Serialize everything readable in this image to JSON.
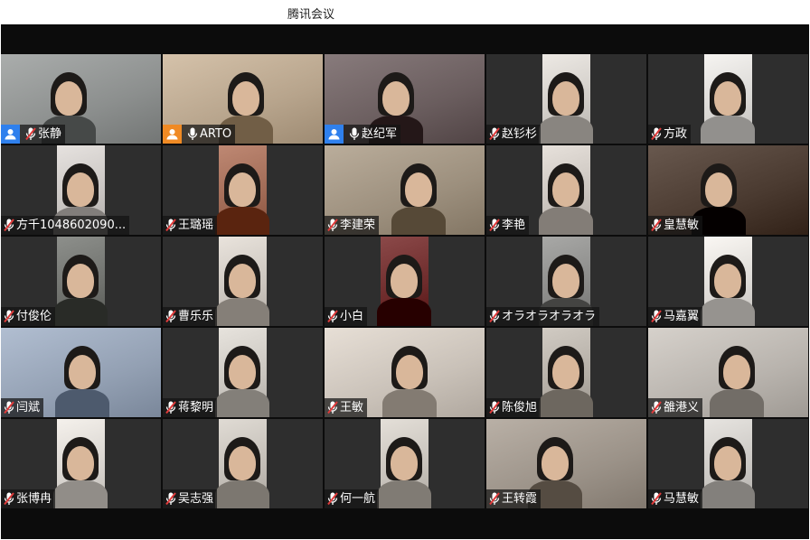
{
  "window": {
    "title": "腾讯会议"
  },
  "participants": [
    {
      "name": "张静",
      "mic": "muted",
      "role": "host",
      "badge_color": "#2f80ed",
      "bg": "#8c8f8e"
    },
    {
      "name": "ARTO",
      "mic": "active",
      "role": "host",
      "badge_color": "#f08a24",
      "bg": "#b7a48c",
      "active": true
    },
    {
      "name": "赵纪军",
      "mic": "active",
      "role": "host",
      "badge_color": "#2f80ed",
      "bg": "#6a5d5e"
    },
    {
      "name": "赵钐杉",
      "mic": "muted",
      "role": "",
      "bg": "#cfcbc6"
    },
    {
      "name": "方政",
      "mic": "muted",
      "role": "",
      "bg": "#d8d6d3"
    },
    {
      "name": "方千1048602090...",
      "mic": "muted",
      "role": "",
      "bg": "#c8c4c1"
    },
    {
      "name": "王璐瑶",
      "mic": "muted",
      "role": "",
      "bg": "#a06a55"
    },
    {
      "name": "李建荣",
      "mic": "muted",
      "role": "",
      "bg": "#9c8f7d"
    },
    {
      "name": "李艳",
      "mic": "muted",
      "role": "",
      "bg": "#c9c3bd"
    },
    {
      "name": "皇慧敏",
      "mic": "muted",
      "role": "",
      "bg": "#4a3a30"
    },
    {
      "name": "付俊伦",
      "mic": "muted",
      "role": "",
      "bg": "#6f716d"
    },
    {
      "name": "曹乐乐",
      "mic": "muted",
      "role": "",
      "bg": "#cbc5be"
    },
    {
      "name": "小白",
      "mic": "muted",
      "role": "",
      "bg": "#6d2b2b"
    },
    {
      "name": "オラオラオラオラ",
      "mic": "muted",
      "role": "",
      "bg": "#8a8a88"
    },
    {
      "name": "马嘉翼",
      "mic": "muted",
      "role": "",
      "bg": "#dcd9d5"
    },
    {
      "name": "闫斌",
      "mic": "muted",
      "role": "",
      "bg": "#93a0b3"
    },
    {
      "name": "蒋黎明",
      "mic": "muted",
      "role": "",
      "bg": "#c9c5bf"
    },
    {
      "name": "王敏",
      "mic": "muted",
      "role": "",
      "bg": "#c9c1b8"
    },
    {
      "name": "陈俊旭",
      "mic": "muted",
      "role": "",
      "bg": "#b3ada5"
    },
    {
      "name": "雒港义",
      "mic": "muted",
      "role": "",
      "bg": "#b8b3ad"
    },
    {
      "name": "张博冉",
      "mic": "muted",
      "role": "",
      "bg": "#d7d3ce"
    },
    {
      "name": "吴志强",
      "mic": "muted",
      "role": "",
      "bg": "#c2bdb6"
    },
    {
      "name": "何一航",
      "mic": "muted",
      "role": "",
      "bg": "#c6c1ba"
    },
    {
      "name": "王转霞",
      "mic": "muted",
      "role": "",
      "bg": "#9b9288"
    },
    {
      "name": "马慧敏",
      "mic": "muted",
      "role": "",
      "bg": "#c9c6c2"
    }
  ]
}
